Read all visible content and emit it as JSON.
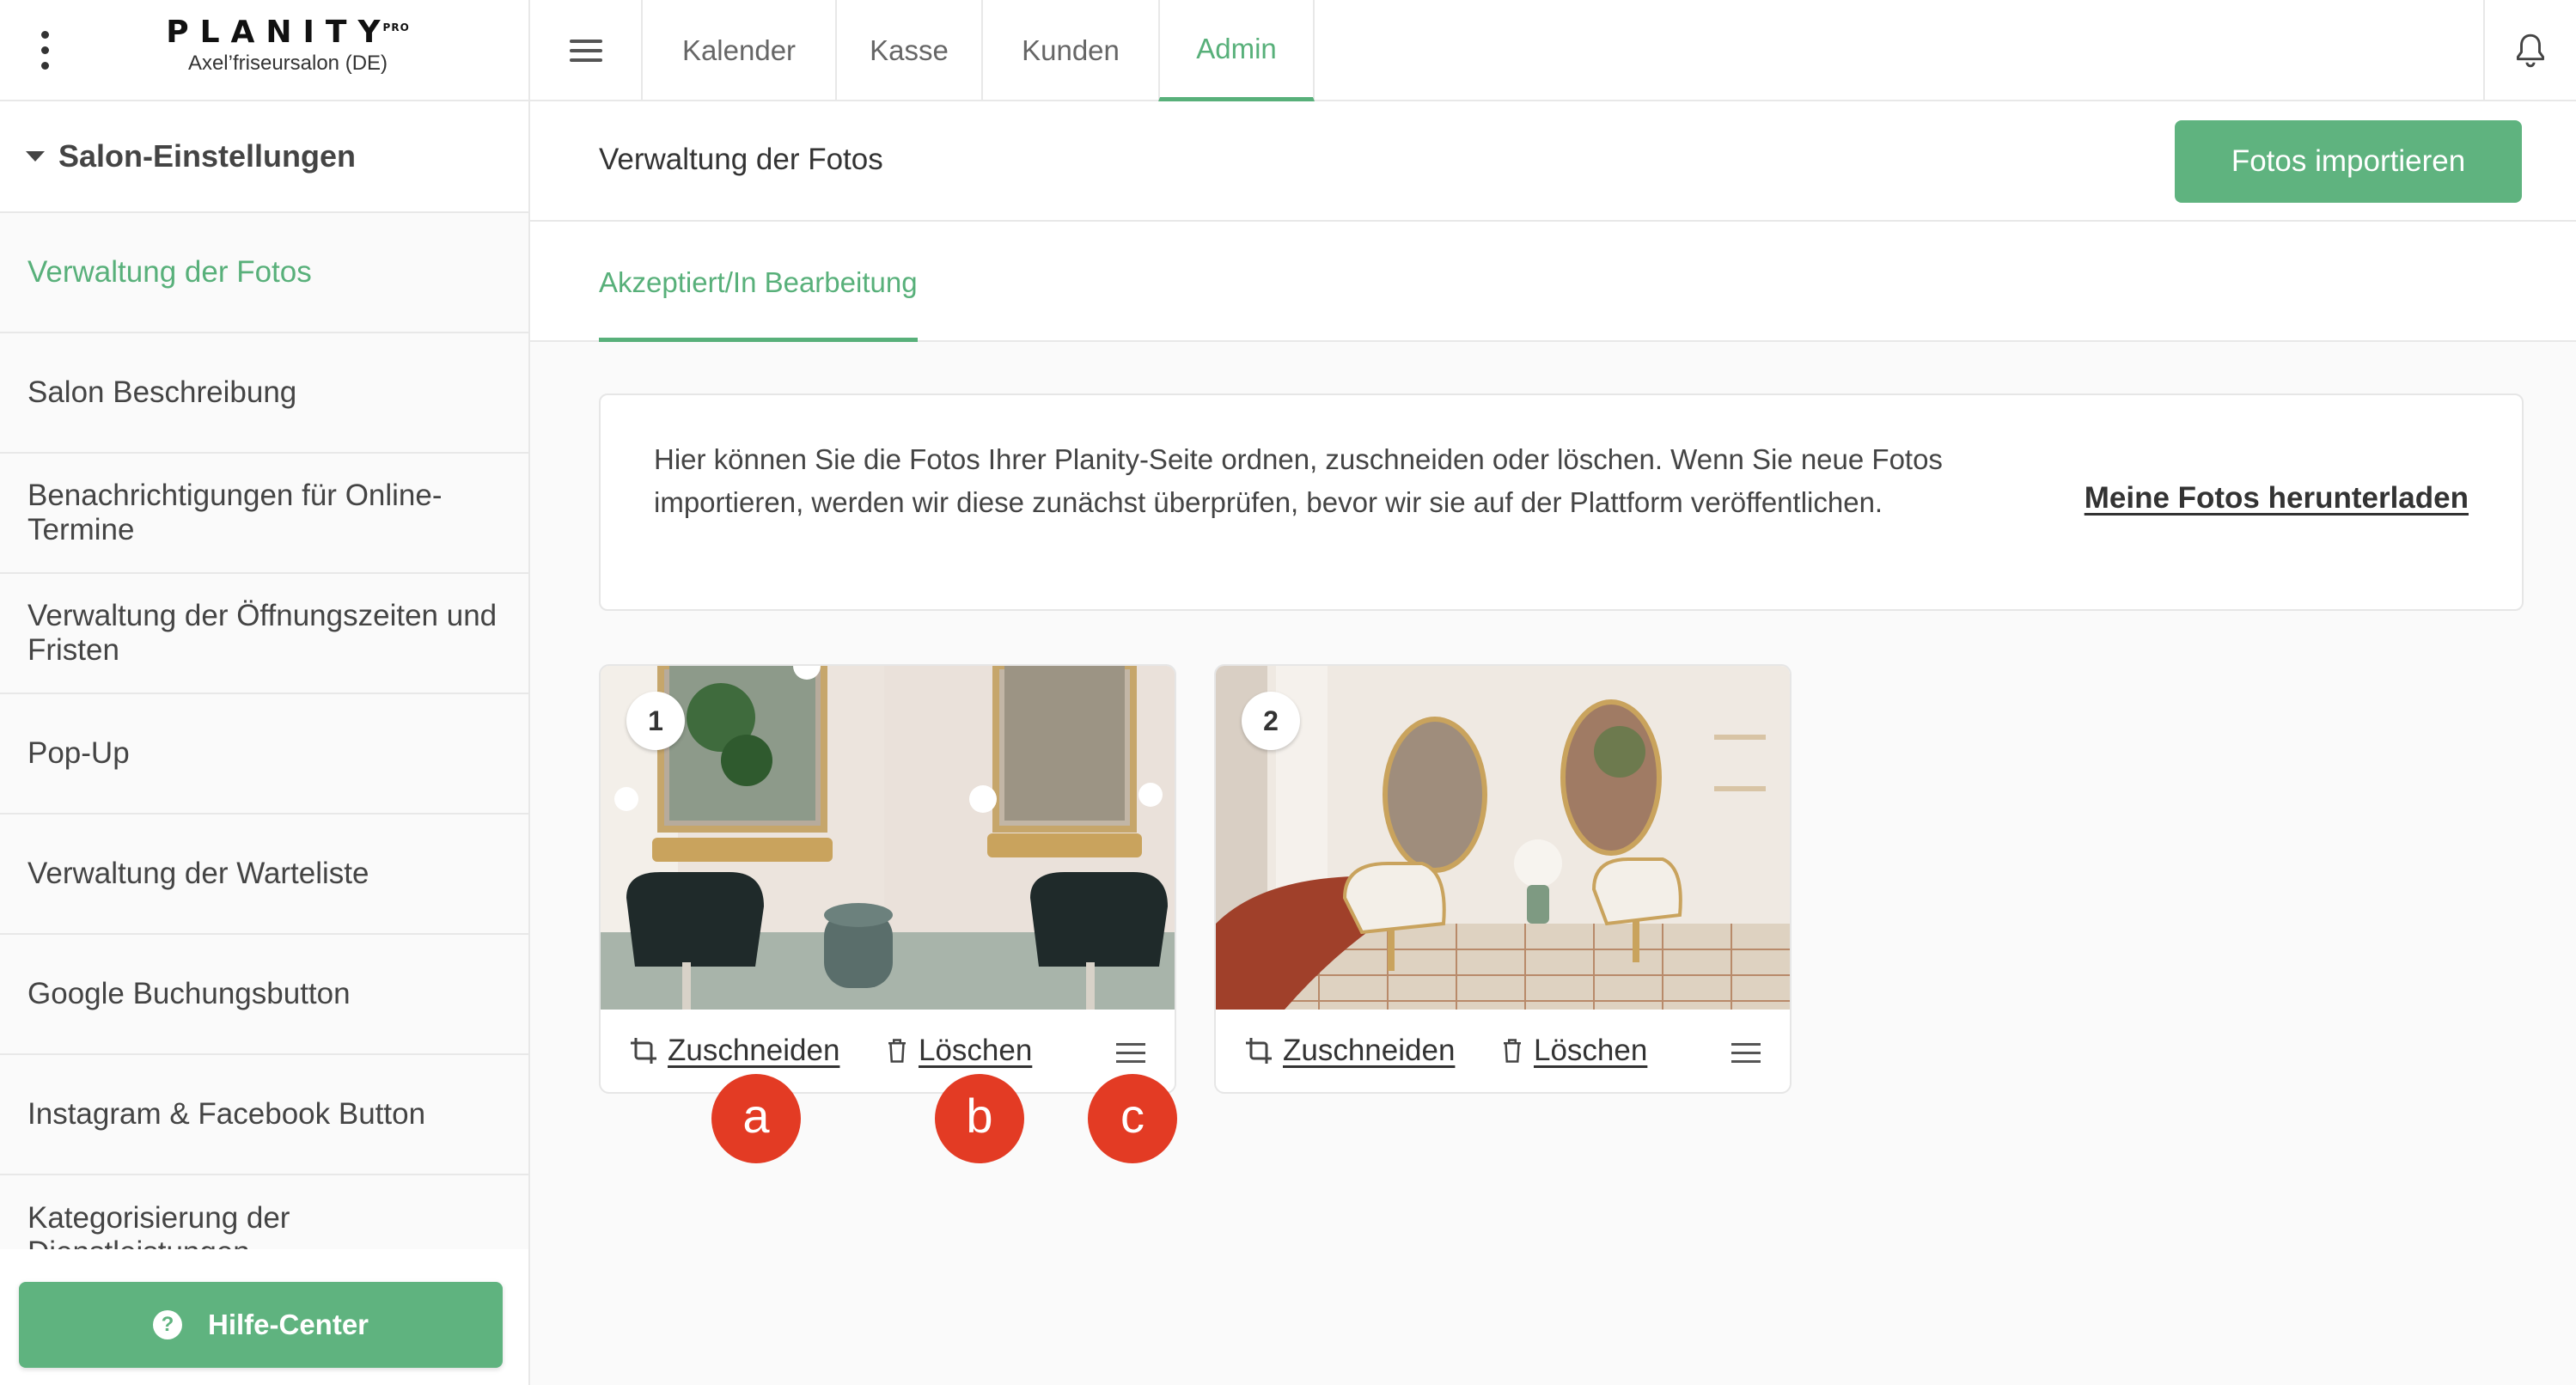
{
  "header": {
    "brand": "PLANITY",
    "brand_badge": "PRO",
    "salon_name": "Axel’friseursalon (DE)",
    "nav_tabs": [
      {
        "label": "Kalender",
        "active": false
      },
      {
        "label": "Kasse",
        "active": false
      },
      {
        "label": "Kunden",
        "active": false
      },
      {
        "label": "Admin",
        "active": true
      }
    ],
    "icons": {
      "menu": "kebab-menu-icon",
      "sidebar_toggle": "hamburger-icon",
      "notifications": "bell-icon"
    }
  },
  "sidebar": {
    "section_title": "Salon-Einstellungen",
    "items": [
      {
        "label": "Verwaltung der Fotos",
        "active": true
      },
      {
        "label": "Salon Beschreibung",
        "active": false
      },
      {
        "label": "Benachrichtigungen für Online-Termine",
        "active": false
      },
      {
        "label": "Verwaltung der Öffnungszeiten und Fristen",
        "active": false
      },
      {
        "label": "Pop-Up",
        "active": false
      },
      {
        "label": "Verwaltung der Warteliste",
        "active": false
      },
      {
        "label": "Google Buchungsbutton",
        "active": false
      },
      {
        "label": "Instagram & Facebook Button",
        "active": false
      },
      {
        "label": "Kategorisierung der Dienstleistungen",
        "active": false
      }
    ],
    "help_button": "Hilfe-Center"
  },
  "main": {
    "title": "Verwaltung der Fotos",
    "import_button": "Fotos importieren",
    "tab": "Akzeptiert/In Bearbeitung",
    "info_text": "Hier können Sie die Fotos Ihrer Planity-Seite ordnen, zuschneiden oder löschen. Wenn Sie neue Fotos importieren, werden wir diese zunächst überprüfen, bevor wir sie auf der Plattform veröffentlichen.",
    "download_link": "Meine Fotos herunterladen",
    "photos": [
      {
        "number": "1",
        "crop_label": "Zuschneiden",
        "delete_label": "Löschen"
      },
      {
        "number": "2",
        "crop_label": "Zuschneiden",
        "delete_label": "Löschen"
      }
    ]
  },
  "annotations": [
    "a",
    "b",
    "c"
  ],
  "colors": {
    "accent": "#58b07a",
    "button": "#5fb37f",
    "marker": "#e33b24"
  }
}
